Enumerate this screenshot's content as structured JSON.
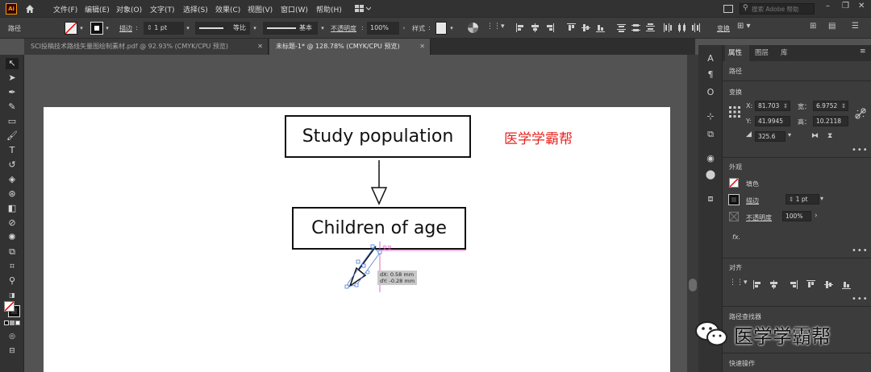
{
  "menubar": {
    "logo": "Ai",
    "items": [
      "文件(F)",
      "编辑(E)",
      "对象(O)",
      "文字(T)",
      "选择(S)",
      "效果(C)",
      "视图(V)",
      "窗口(W)",
      "帮助(H)"
    ],
    "search_placeholder": "搜索 Adobe 帮助"
  },
  "control_bar": {
    "mode": "路径",
    "stroke_label": "描边",
    "stroke_weight": "1 pt",
    "stroke_style": "等比",
    "brush": "基本",
    "opacity_label": "不透明度",
    "opacity": "100%",
    "style_label": "样式",
    "transform_label": "变换"
  },
  "doc_tabs": [
    {
      "label": "SCI投稿技术路线矢量图绘制素材.pdf @ 92.93% (CMYK/CPU 预览)",
      "active": false
    },
    {
      "label": "未标题-1* @ 128.78% (CMYK/CPU 预览)",
      "active": true
    }
  ],
  "canvas": {
    "box1": "Study population",
    "box2": "Children of age",
    "watermark": "医学学霸帮",
    "dx": "dX: 0.58 mm",
    "dy": "dY: -0.28 mm"
  },
  "panel": {
    "tabs": [
      "属性",
      "图层",
      "库"
    ],
    "object_type": "路径",
    "transform": {
      "title": "变换",
      "x_label": "X:",
      "x": "81.703",
      "y_label": "Y:",
      "y": "41.9945",
      "w_label": "宽：",
      "w": "6.9752",
      "h_label": "高：",
      "h": "10.2118",
      "rotate": "325.6"
    },
    "appearance": {
      "title": "外观",
      "fill_label": "填色",
      "stroke_label": "描边",
      "stroke_weight": "1 pt",
      "opacity_label": "不透明度",
      "opacity": "100%",
      "fx": "fx."
    },
    "align_title": "对齐",
    "pathfinder_title": "路径查找器",
    "quick_actions": "快速操作"
  },
  "wechat_watermark": "医学学霸帮",
  "colors": {
    "menubar": "#323232",
    "panel": "#3c3c3c",
    "canvas": "#535353",
    "watermark_red": "#e8231f",
    "selection": "#4a7bd6",
    "guide": "#e040c0"
  }
}
